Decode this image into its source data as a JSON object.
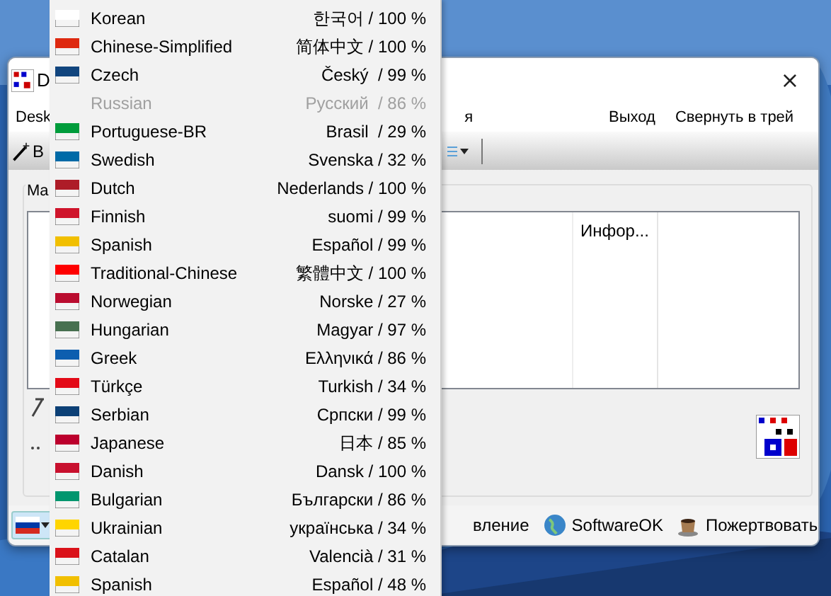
{
  "window": {
    "title": "D",
    "close": "×"
  },
  "menu_bar": [
    "Desk",
    "я",
    "Выход",
    "Свернуть в трей"
  ],
  "toolbar": {
    "button": "B"
  },
  "group": {
    "label": "Ma",
    "column_header": "Инфор..."
  },
  "status_bar": [
    {
      "kind": "text",
      "label": "вление"
    },
    {
      "kind": "globe",
      "label": "SoftwareOK"
    },
    {
      "kind": "cup",
      "label": "Пожертвовать"
    }
  ],
  "language_menu": [
    {
      "name": "Korean",
      "native": "한국어 / 100 %",
      "color": "#ffffff",
      "disabled": false
    },
    {
      "name": "Chinese-Simplified",
      "native": "简体中文 / 100 %",
      "color": "#de2910",
      "disabled": false
    },
    {
      "name": "Czech",
      "native": "Český  / 99 %",
      "color": "#11457e",
      "disabled": false
    },
    {
      "name": "Russian",
      "native": "Русский  / 86 %",
      "disabled": true
    },
    {
      "name": "Portuguese-BR",
      "native": "Brasil  / 29 %",
      "color": "#009c3b",
      "disabled": false
    },
    {
      "name": "Swedish",
      "native": "Svenska / 32 %",
      "color": "#006aa7",
      "disabled": false
    },
    {
      "name": "Dutch",
      "native": "Nederlands / 100 %",
      "color": "#ae1c28",
      "disabled": false
    },
    {
      "name": "Finnish",
      "native": "suomi / 99 %",
      "color": "#cf142b",
      "disabled": false
    },
    {
      "name": "Spanish",
      "native": "Español / 99 %",
      "color": "#f1bf00",
      "disabled": false
    },
    {
      "name": "Traditional-Chinese",
      "native": "繁體中文 / 100 %",
      "color": "#fe0000",
      "disabled": false
    },
    {
      "name": "Norwegian",
      "native": "Norske / 27 %",
      "color": "#ba0c2f",
      "disabled": false
    },
    {
      "name": "Hungarian",
      "native": "Magyar / 97 %",
      "color": "#477050",
      "disabled": false
    },
    {
      "name": "Greek",
      "native": "Ελληνικά / 86 %",
      "color": "#0d5eaf",
      "disabled": false
    },
    {
      "name": "Türkçe",
      "native": "Turkish / 34 %",
      "color": "#e30a17",
      "disabled": false
    },
    {
      "name": "Serbian",
      "native": "Српски / 99 %",
      "color": "#0c4076",
      "disabled": false
    },
    {
      "name": "Japanese",
      "native": "日本 / 85 %",
      "color": "#bc002d",
      "disabled": false
    },
    {
      "name": "Danish",
      "native": "Dansk / 100 %",
      "color": "#c8102e",
      "disabled": false
    },
    {
      "name": "Bulgarian",
      "native": "Български / 86 %",
      "color": "#00966e",
      "disabled": false
    },
    {
      "name": "Ukrainian",
      "native": "українська / 34 %",
      "color": "#ffd500",
      "disabled": false
    },
    {
      "name": "Catalan",
      "native": "Valencià / 31 %",
      "color": "#da121a",
      "disabled": false
    },
    {
      "name": "Spanish",
      "native": "Español / 48 %",
      "color": "#f1bf00",
      "disabled": false
    }
  ]
}
